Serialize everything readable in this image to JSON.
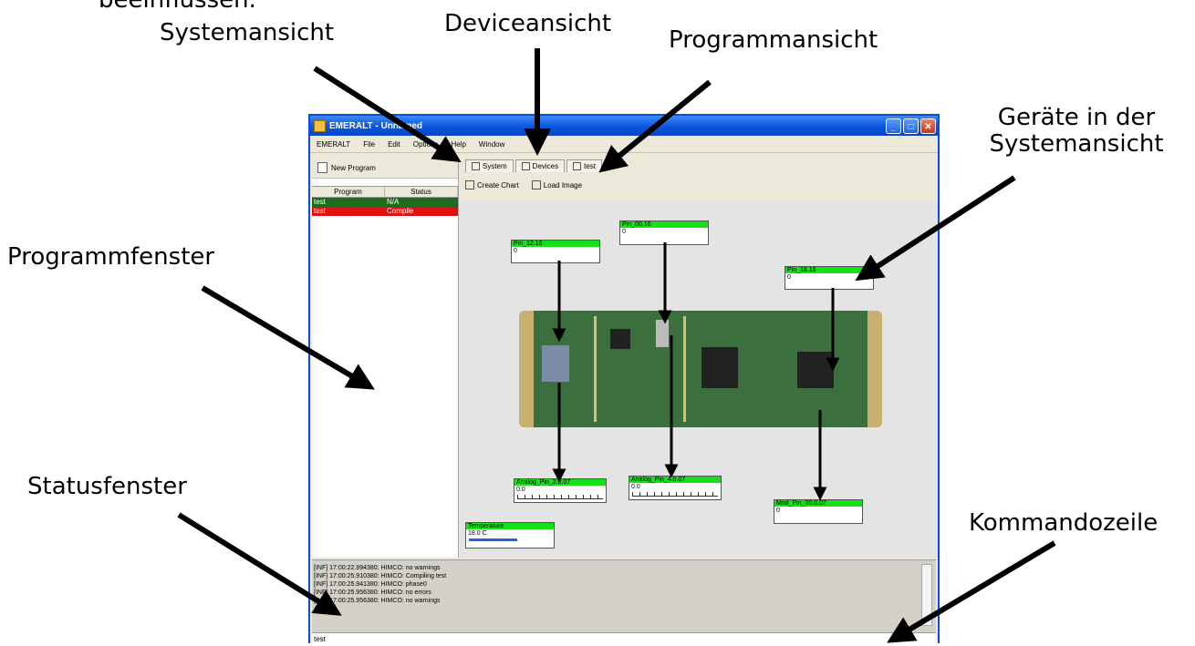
{
  "callouts": {
    "top_fragment": "beeinflussen.",
    "system_view": "Systemansicht",
    "device_view": "Deviceansicht",
    "program_view": "Programmansicht",
    "devices_in_system_view": "Geräte in der Systemansicht",
    "program_window": "Programmfenster",
    "status_window": "Statusfenster",
    "command_line": "Kommandozeile"
  },
  "window": {
    "title": "EMERALT - Unnamed",
    "controls": {
      "minimize": "_",
      "maximize": "□",
      "close": "✕"
    },
    "menu": [
      "EMERALT",
      "File",
      "Edit",
      "Options",
      "Help",
      "Window"
    ]
  },
  "left_panel": {
    "new_program_label": "New Program",
    "columns": [
      "Program",
      "Status"
    ],
    "rows": [
      {
        "name": "test",
        "status": "N/A",
        "color": "#1e6b1e"
      },
      {
        "name": "test",
        "status": "Compile",
        "color": "#e01010"
      }
    ]
  },
  "tabs": [
    "System",
    "Devices",
    "test"
  ],
  "toolbar": {
    "create_chart": "Create Chart",
    "load_image": "Load Image"
  },
  "devices": [
    {
      "name": "Pin_12.16",
      "value": "0"
    },
    {
      "name": "Pin_00.16",
      "value": "0"
    },
    {
      "name": "Pin_18.16",
      "value": "0"
    },
    {
      "name": "Analog_Pin_2.0.07",
      "value": "0.0"
    },
    {
      "name": "Analog_Pin_4.0.07",
      "value": "0.0"
    },
    {
      "name": "Mod_Pin_00.0.07",
      "value": "0"
    },
    {
      "name": "Temperature",
      "value": "18.0 C"
    }
  ],
  "status_lines": [
    "[INF] 17:00:22.994380: HIMCO: no warnings",
    "[INF] 17:00:25.910380: HIMCO: Compiling test",
    "[INF] 17:00:25.941380: HIMCO: phase0",
    "[INF] 17:00:25.956380: HIMCO: no errors",
    "[INF] 17:00:25.956380: HIMCO: no warnings"
  ],
  "command_line_text": "test",
  "colors": {
    "titlebar": "#0a55e0",
    "device_header": "#18e018",
    "accent_red": "#e01010",
    "accent_green": "#1e6b1e"
  },
  "icons": [
    "app-icon",
    "new-program-icon",
    "system-tab-icon",
    "devices-tab-icon",
    "program-tab-icon",
    "create-chart-icon",
    "load-image-icon",
    "arrow-icon"
  ]
}
